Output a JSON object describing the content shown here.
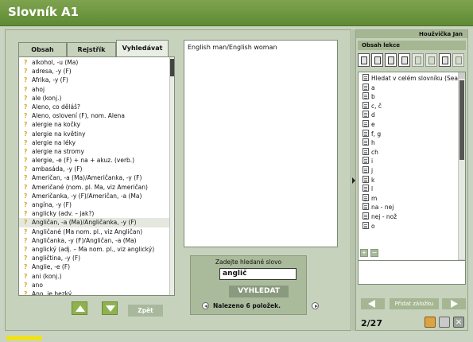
{
  "app": {
    "title": "Slovník A1"
  },
  "tabs": [
    {
      "label": "Obsah"
    },
    {
      "label": "Rejstřík"
    },
    {
      "label": "Vyhledávat"
    }
  ],
  "word_list": [
    "alkohol, -u (Ma)",
    "adresa, -y (F)",
    "Afrika, -y (F)",
    "ahoj",
    "ale (konj.)",
    "Aleno, co děláš?",
    "Aleno, oslovení (F), nom. Alena",
    "alergie na kočky",
    "alergie na květiny",
    "alergie na léky",
    "alergie na stromy",
    "alergie, -e (F) + na  + akuz. (verb.)",
    "ambasáda, -y (F)",
    "Američan, -a (Ma)/Američanka, -y (F)",
    "Američané (nom. pl. Ma, viz Američan)",
    "Američanka, -y (F)/Američan, -a (Ma)",
    "angína, -y (F)",
    "anglicky (adv. – jak?)",
    "Angličan, -a (Ma)/Angličanka, -y (F)",
    "Angličané (Ma nom. pl., viz Angličan)",
    "Angličanka, -y (F)/Angličan, -a (Ma)",
    "anglický (adj. – Ma nom. pl., viz anglický)",
    "angličtina, -y (F)",
    "Anglie, -e (F)",
    "ani (konj.)",
    "ano",
    "Ano, je hezký."
  ],
  "selected_word_index": 18,
  "content": {
    "text": "English man/English woman"
  },
  "search": {
    "label": "Zadejte hledané slovo",
    "value": "anglič",
    "button": "VYHLEDAT",
    "result": "Nalezeno 6 položek."
  },
  "left_nav": {
    "back_label": "Zpět"
  },
  "user": {
    "name": "Houžvička Jan"
  },
  "lesson_panel": {
    "header": "Obsah lekce",
    "tree": [
      "Hledat v celém slovníku (Search",
      "a",
      "b",
      "c, č",
      "d",
      "e",
      "f, g",
      "h",
      "ch",
      "i",
      "j",
      "k",
      "l",
      "m",
      "na - nej",
      "nej - nož",
      "o"
    ],
    "toolbar_icons": [
      "book-icon",
      "book-open-icon",
      "book-icon",
      "book-stack-icon",
      "copy-icon",
      "print-icon",
      "settings-icon",
      "edit-icon"
    ]
  },
  "bookmarks": {
    "add_label": "Přidat záložku",
    "page": "2/27"
  },
  "progress": {
    "fraction": 0.075
  },
  "colors": {
    "header_green": "#6b9440",
    "accent_yellow": "#f0e120",
    "panel_bg": "#c7d2bd"
  }
}
